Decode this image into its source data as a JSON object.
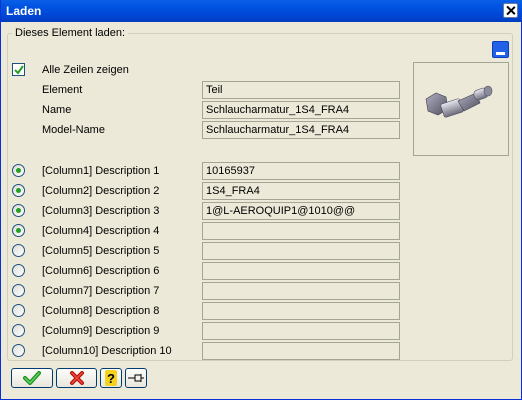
{
  "window": {
    "title": "Laden"
  },
  "group": {
    "legend": "Dieses Element laden:"
  },
  "show_all": {
    "label": "Alle Zeilen zeigen",
    "checked": true
  },
  "info_rows": [
    {
      "label": "Element",
      "value": "Teil"
    },
    {
      "label": "Name",
      "value": "Schlaucharmatur_1S4_FRA4"
    },
    {
      "label": "Model-Name",
      "value": "Schlaucharmatur_1S4_FRA4"
    }
  ],
  "columns": [
    {
      "label": "[Column1] Description 1",
      "value": "10165937",
      "selected": true
    },
    {
      "label": "[Column2] Description 2",
      "value": "1S4_FRA4",
      "selected": true
    },
    {
      "label": "[Column3] Description 3",
      "value": "1@L-AEROQUIP1@1010@@",
      "selected": true
    },
    {
      "label": "[Column4] Description 4",
      "value": "",
      "selected": true
    },
    {
      "label": "[Column5] Description 5",
      "value": "",
      "selected": false
    },
    {
      "label": "[Column6] Description 6",
      "value": "",
      "selected": false
    },
    {
      "label": "[Column7] Description 7",
      "value": "",
      "selected": false
    },
    {
      "label": "[Column8] Description 8",
      "value": "",
      "selected": false
    },
    {
      "label": "[Column9] Description 9",
      "value": "",
      "selected": false
    },
    {
      "label": "[Column10] Description 10",
      "value": "",
      "selected": false
    }
  ],
  "icons": {
    "close": "close-icon",
    "minimize": "minimize-icon",
    "preview": "hose-fitting-preview",
    "ok": "checkmark-icon",
    "cancel": "x-icon",
    "help": "question-icon",
    "pin": "pin-icon"
  },
  "colors": {
    "titlebar": "#0053e1",
    "dialog": "#ece9d8",
    "ok_green": "#2fa62f",
    "cancel_red": "#d8231c",
    "help_yellow": "#f4d21f"
  }
}
